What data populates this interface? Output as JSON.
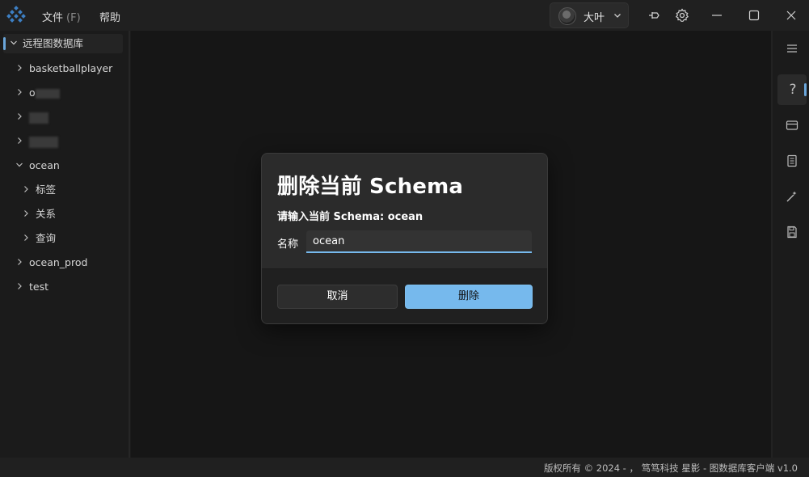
{
  "titlebar": {
    "menu": [
      {
        "label": "文件",
        "hotkey": "(F)"
      },
      {
        "label": "帮助"
      }
    ],
    "user": {
      "name": "大叶"
    },
    "icons": [
      "pin-icon",
      "gear-icon",
      "minimize-icon",
      "maximize-icon",
      "close-icon"
    ]
  },
  "sidebar": {
    "root": {
      "label": "远程图数据库"
    },
    "items": [
      {
        "label": "basketballplayer"
      },
      {
        "label": "o"
      },
      {
        "label": ""
      },
      {
        "label": ""
      },
      {
        "label": "ocean",
        "children": [
          {
            "label": "标签"
          },
          {
            "label": "关系"
          },
          {
            "label": "查询"
          }
        ]
      },
      {
        "label": "ocean_prod"
      },
      {
        "label": "test"
      }
    ]
  },
  "rail": {
    "icons": [
      "menu-icon",
      "help-icon",
      "card-icon",
      "document-icon",
      "magic-wand-icon",
      "save-icon"
    ],
    "help_glyph": "?"
  },
  "dialog": {
    "title": "删除当前 Schema",
    "prompt": "请输入当前 Schema: ocean",
    "name_label": "名称",
    "name_value": "ocean",
    "cancel_label": "取消",
    "delete_label": "删除"
  },
  "footer": {
    "text": "版权所有 © 2024 - ， 笃笃科技   星影 - 图数据库客户端  v1.0"
  },
  "colors": {
    "accent": "#76b9ed",
    "background": "#1c1c1c",
    "dialog": "#2b2b2b"
  }
}
